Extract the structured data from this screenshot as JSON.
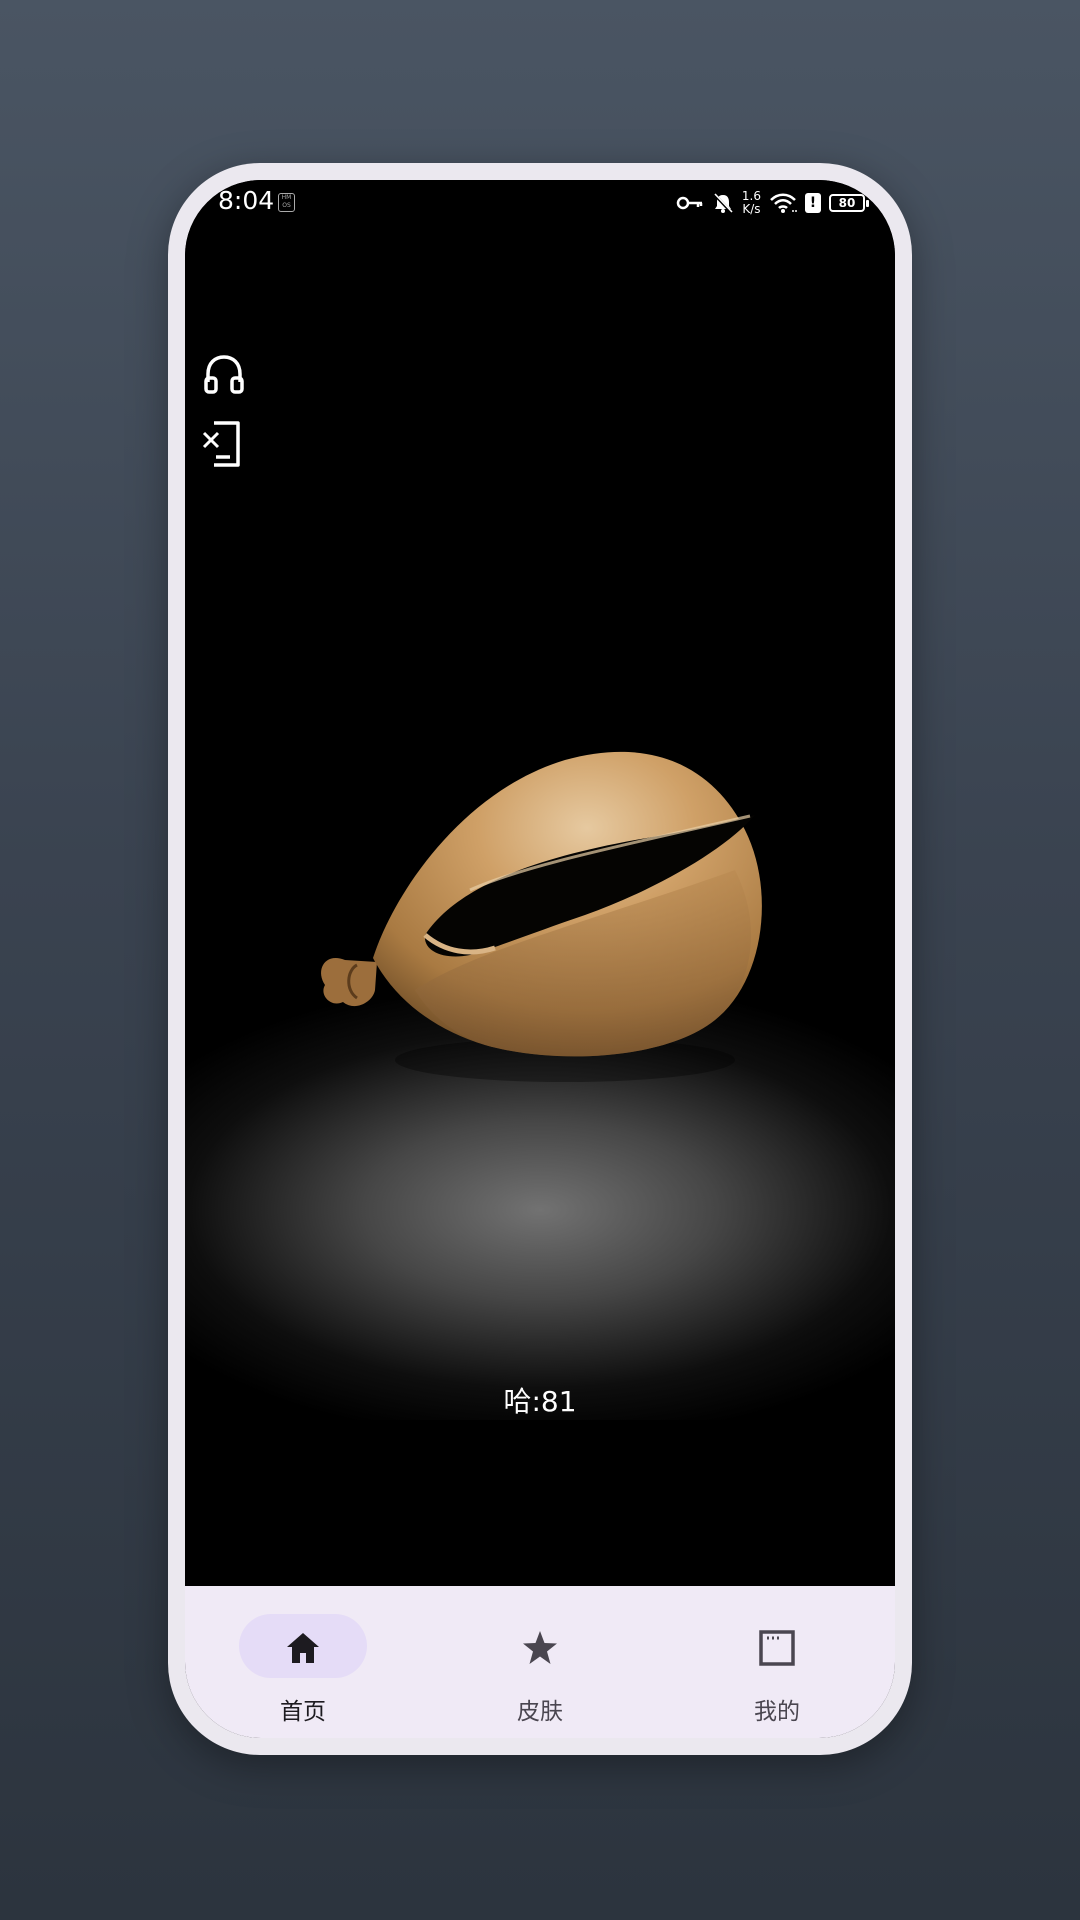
{
  "status_bar": {
    "time": "8:04",
    "hm_badge": "HM OS",
    "net_speed_value": "1.6",
    "net_speed_unit": "K/s",
    "battery": "80",
    "icons": [
      "key-icon",
      "bell-muted-icon",
      "wifi-icon",
      "alert-icon",
      "battery-icon"
    ]
  },
  "side_actions": [
    {
      "name": "headset-icon"
    },
    {
      "name": "screen-exit-icon"
    }
  ],
  "main": {
    "counter_text": "哈:81"
  },
  "bottom_nav": {
    "items": [
      {
        "label": "首页",
        "icon": "home-icon",
        "active": true
      },
      {
        "label": "皮肤",
        "icon": "star-icon",
        "active": false
      },
      {
        "label": "我的",
        "icon": "window-icon",
        "active": false
      }
    ]
  },
  "colors": {
    "background_top": "#4a5563",
    "background_bottom": "#2c343e",
    "phone_frame": "#ebe8ef",
    "nav_bg": "#f0eaf6",
    "nav_active_pill": "#e5dcf7",
    "wooden_fish": "#c99a60"
  }
}
